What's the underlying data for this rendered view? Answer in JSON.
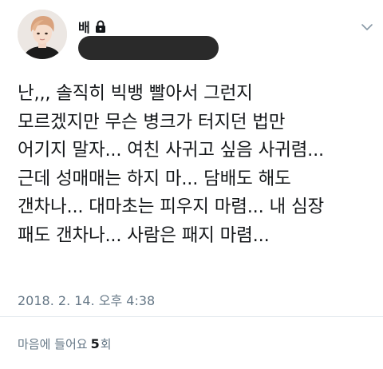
{
  "author": {
    "display_name": "배",
    "protected_icon": "lock-icon",
    "avatar_icon": "profile-avatar"
  },
  "menu": {
    "icon": "chevron-down-icon"
  },
  "tweet": {
    "lines": [
      "난,,, 솔직히 빅뱅 빨아서 그런지",
      "모르겠지만 무슨 병크가 터지던 법만",
      "어기지 말자... 여친 사귀고 싶음 사귀렴...",
      "근데 성매매는 하지 마... 담배도 해도",
      "갠차나... 대마초는 피우지 마렴... 내 심장",
      "패도 갠차나... 사람은 패지 마렴..."
    ],
    "timestamp": "2018. 2. 14. 오후 4:38"
  },
  "likes": {
    "prefix": "마음에 들어요",
    "count": "5",
    "suffix": "회"
  },
  "colors": {
    "text": "#14171a",
    "secondary": "#657786",
    "divider": "#e1e8ed",
    "redaction": "#2a2a2a"
  }
}
